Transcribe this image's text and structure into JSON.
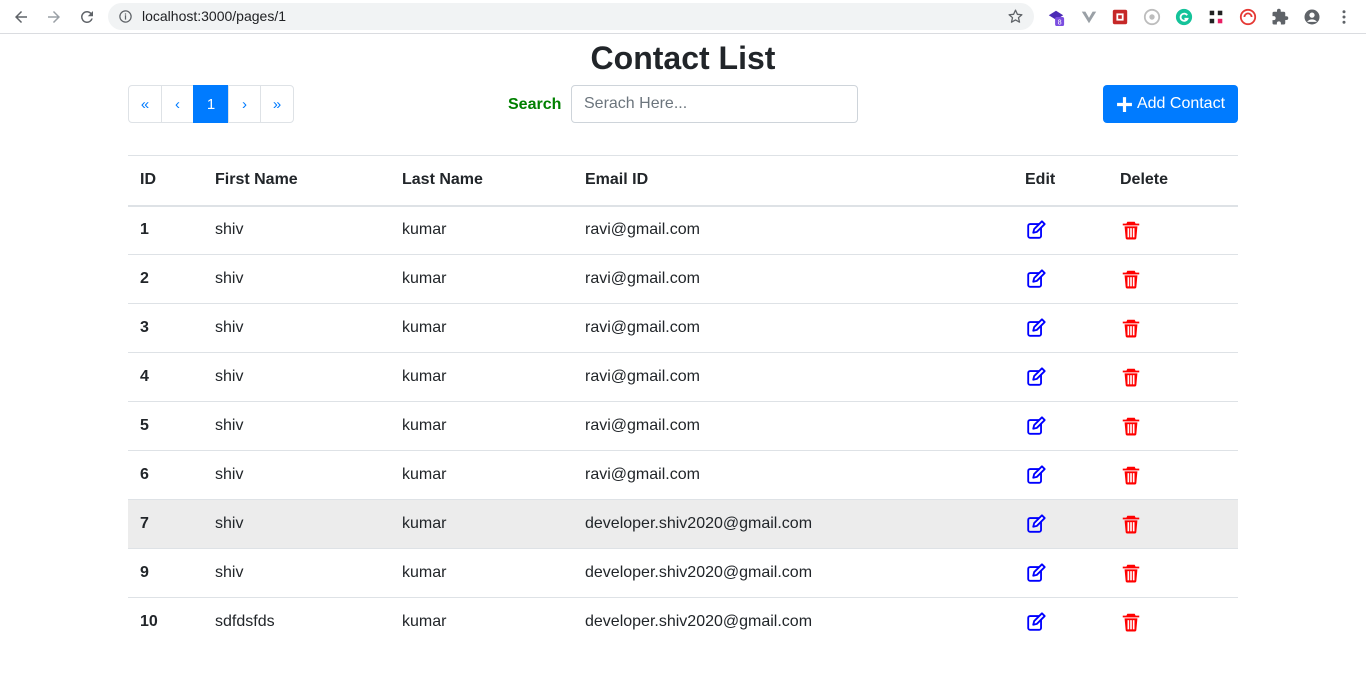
{
  "browser": {
    "url": "localhost:3000/pages/1",
    "extension_badge": "8"
  },
  "page": {
    "title": "Contact List"
  },
  "pagination": {
    "first": "«",
    "prev": "‹",
    "current": "1",
    "next": "›",
    "last": "»"
  },
  "search": {
    "label": "Search",
    "placeholder": "Serach Here..."
  },
  "add_button": {
    "label": "Add Contact"
  },
  "table": {
    "headers": {
      "id": "ID",
      "first_name": "First Name",
      "last_name": "Last Name",
      "email": "Email ID",
      "edit": "Edit",
      "delete": "Delete"
    },
    "rows": [
      {
        "id": "1",
        "first_name": "shiv",
        "last_name": "kumar",
        "email": "ravi@gmail.com"
      },
      {
        "id": "2",
        "first_name": "shiv",
        "last_name": "kumar",
        "email": "ravi@gmail.com"
      },
      {
        "id": "3",
        "first_name": "shiv",
        "last_name": "kumar",
        "email": "ravi@gmail.com"
      },
      {
        "id": "4",
        "first_name": "shiv",
        "last_name": "kumar",
        "email": "ravi@gmail.com"
      },
      {
        "id": "5",
        "first_name": "shiv",
        "last_name": "kumar",
        "email": "ravi@gmail.com"
      },
      {
        "id": "6",
        "first_name": "shiv",
        "last_name": "kumar",
        "email": "ravi@gmail.com"
      },
      {
        "id": "7",
        "first_name": "shiv",
        "last_name": "kumar",
        "email": "developer.shiv2020@gmail.com"
      },
      {
        "id": "9",
        "first_name": "shiv",
        "last_name": "kumar",
        "email": "developer.shiv2020@gmail.com"
      },
      {
        "id": "10",
        "first_name": "sdfdsfds",
        "last_name": "kumar",
        "email": "developer.shiv2020@gmail.com"
      }
    ],
    "edit_icon": "edit-icon",
    "delete_icon": "trash-icon",
    "edit_color": "#0000ff",
    "delete_color": "#ff0000"
  },
  "colors": {
    "primary": "#007bff",
    "search_label": "#008000",
    "hover_row": "#ececec"
  }
}
